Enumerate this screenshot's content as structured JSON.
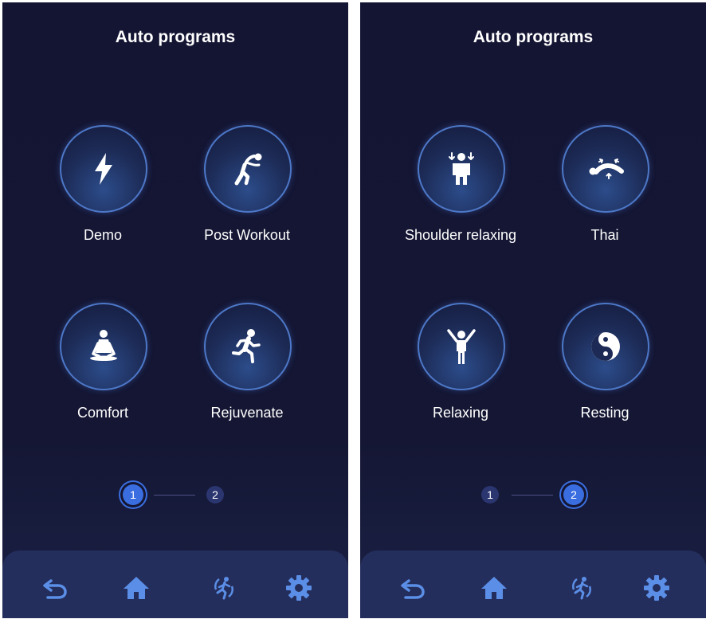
{
  "screens": [
    {
      "title": "Auto programs",
      "programs": [
        {
          "label": "Demo",
          "icon": "lightning-bolt-icon"
        },
        {
          "label": "Post Workout",
          "icon": "stretching-person-icon"
        },
        {
          "label": "Comfort",
          "icon": "meditating-person-icon"
        },
        {
          "label": "Rejuvenate",
          "icon": "running-person-icon"
        }
      ],
      "pager": {
        "pages": [
          "1",
          "2"
        ],
        "active": "1"
      }
    },
    {
      "title": "Auto programs",
      "programs": [
        {
          "label": "Shoulder relaxing",
          "icon": "shoulder-person-icon"
        },
        {
          "label": "Thai",
          "icon": "thai-massage-icon"
        },
        {
          "label": "Relaxing",
          "icon": "arms-up-person-icon"
        },
        {
          "label": "Resting",
          "icon": "yin-yang-icon"
        }
      ],
      "pager": {
        "pages": [
          "1",
          "2"
        ],
        "active": "2"
      }
    }
  ],
  "navbar": {
    "icons": [
      "back-arrow-icon",
      "home-icon",
      "massage-mode-icon",
      "settings-gear-icon"
    ]
  },
  "colors": {
    "background": "#141633",
    "accent": "#3a6ee0",
    "circle_border": "#4d78c8",
    "navbar": "#242e5c"
  }
}
